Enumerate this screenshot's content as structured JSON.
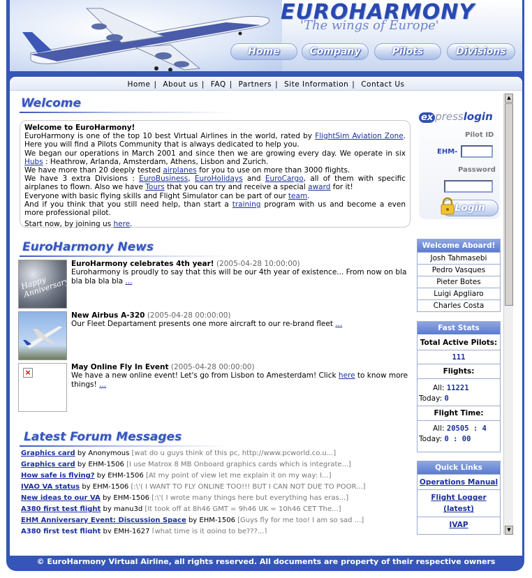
{
  "brand": {
    "name": "EUROHARMONY",
    "slogan": "'The wings of Europe'"
  },
  "nav_buttons": [
    "Home",
    "Company",
    "Pilots",
    "Divisions"
  ],
  "top_links": [
    "Home",
    "About us",
    "FAQ",
    "Partners",
    "Site Information",
    "Contact Us"
  ],
  "welcome": {
    "title": "Welcome",
    "heading": "Welcome to EuroHarmony!",
    "p1_a": "EuroHarmony is one of the top 10 best Virtual Airlines in the world, rated by ",
    "p1_link": "FlightSim Aviation Zone",
    "p1_b": ". Here you will find a Pilots Community that is always dedicated to help you.",
    "p2_a": "We began our operations in March 2001 and since then we are growing every day. We operate in six ",
    "p2_link": "Hubs",
    "p2_b": " : Heathrow, Arlanda, Amsterdam, Athens, Lisbon and Zurich.",
    "p3_a": "We have more than 20 deeply tested ",
    "p3_link": "airplanes",
    "p3_b": " for you to use on more than 3000 flights.",
    "p4_a": "We have 3 extra Divisions : ",
    "p4_link1": "EuroBusiness",
    "p4_sep1": ", ",
    "p4_link2": "EuroHolidays",
    "p4_sep2": " and ",
    "p4_link3": "EuroCargo",
    "p4_b": ", all of them with specific airplanes to flown. Also we have ",
    "p4_link4": "Tours",
    "p4_c": " that you can try and receive a special ",
    "p4_link5": "award",
    "p4_d": " for it!",
    "p5_a": "Everyone with basic flying skills and Flight Simulator can be part of our ",
    "p5_link": "team",
    "p5_b": ".",
    "p6_a": "And if you think that you still need help, than start a ",
    "p6_link": "training",
    "p6_b": " program with us and become a even more professional pilot.",
    "p7_a": "Start now, by joining us ",
    "p7_link": "here",
    "p7_b": "."
  },
  "news": {
    "title": "EuroHarmony News",
    "items": [
      {
        "title": "EuroHarmony celebrates 4th year!",
        "date": "(2005-04-28 10:00:00)",
        "body": "Euroharmony is proudly to say that this will be our 4th year of existence... From now on bla bla bla bla bla",
        "more": "...",
        "thumb_text": "Happy Anniversary"
      },
      {
        "title": "New Airbus A-320",
        "date": "(2005-04-28 00:00:00)",
        "body": "Our Fleet Departament presents one more aircraft to our re-brand fleet",
        "more": "...",
        "thumb_text": ""
      },
      {
        "title": "May Online Fly In Event",
        "date": "(2005-04-28 00:00:00)",
        "body_a": "We have a new online event! Let's go from Lisbon to Amesterdam! Click ",
        "body_link": "here",
        "body_b": " to know more things!",
        "more": "...",
        "thumb_text": "×"
      }
    ]
  },
  "forum": {
    "title": "Latest Forum Messages",
    "rows": [
      {
        "topic": "Graphics card",
        "by": "by",
        "author": "Anonymous",
        "excerpt": "[wat do u guys think of this pc, http://www.pcworld.co.u...]"
      },
      {
        "topic": "Graphics card",
        "by": "by",
        "author": "EHM-1506",
        "excerpt": "[I use Matrox 8 MB Onboard graphics cards which is integrate...]"
      },
      {
        "topic": "How safe is flying?",
        "by": "by",
        "author": "EHM-1506",
        "excerpt": "[At my point of view let me explain it on my way: I...]"
      },
      {
        "topic": "IVAO VA status",
        "by": "by",
        "author": "EHM-1506",
        "excerpt": "[:\\'( I WANT TO FLY ONLINE TOO!!! BUT I CAN NOT DUE TO POOR...]"
      },
      {
        "topic": "New ideas to our VA",
        "by": "by",
        "author": "EHM-1506",
        "excerpt": "[:\\'( I wrote many things here but everything has eras...]"
      },
      {
        "topic": "A380 first test flight",
        "by": "by",
        "author": "manu3d",
        "excerpt": "[It took off at 8h46 GMT = 9h46 UK = 10h46 CET The...]"
      },
      {
        "topic": "EHM Anniversary Event: Discussion Space",
        "by": "by",
        "author": "EHM-1506",
        "excerpt": "[Guys fly for me too! I am so sad ...]"
      },
      {
        "topic": "A380 first test flight",
        "by": "by",
        "author": "EMH-1627",
        "excerpt": "[what time is it going to be???...]"
      }
    ]
  },
  "login": {
    "logo_ex": "ex",
    "logo_press": "press",
    "logo_login": "login",
    "pilot_id_label": "Pilot ID",
    "prefix": "EHM-",
    "password_label": "Password",
    "button": "Login"
  },
  "welcome_aboard": {
    "title": "Welcome Aboard!",
    "names": [
      "Josh Tahmasebi",
      "Pedro Vasques",
      "Pieter Botes",
      "Luigi Apgliaro",
      "Charles Costa"
    ]
  },
  "fast_stats": {
    "title": "Fast Stats",
    "active_label": "Total Active Pilots:",
    "active_value": "111",
    "flights_label": "Flights:",
    "all_label": "All:",
    "flights_all": "11221",
    "today_label": "Today:",
    "flights_today": "0",
    "time_label": "Flight Time:",
    "time_all": "20505 : 4",
    "time_today": "0 : 00"
  },
  "quick_links": {
    "title": "Quick Links",
    "links": [
      "Operations Manual",
      "Flight Logger (latest)",
      "IVAP"
    ]
  },
  "footer": "© EuroHarmony Virtual Airline, all rights reserved. All documents are property of their respective owners",
  "colors": {
    "frame": "#3556b8",
    "accent": "#3656bf",
    "link": "#1a2f9c"
  }
}
